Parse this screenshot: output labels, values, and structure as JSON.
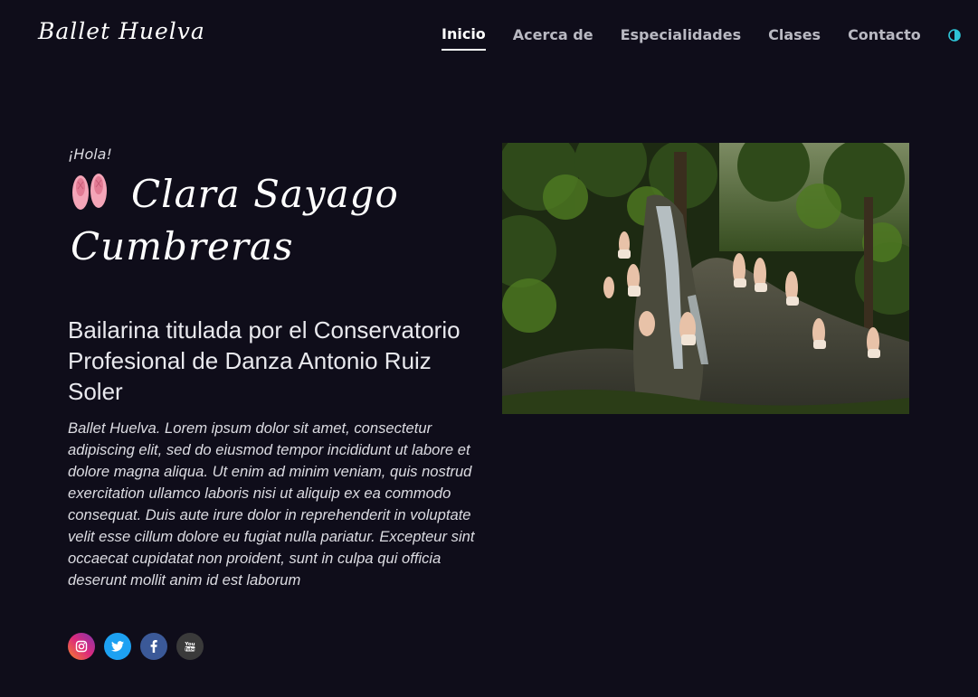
{
  "brand": {
    "logo_text": "Ballet Huelva"
  },
  "nav": {
    "items": [
      {
        "label": "Inicio",
        "active": true
      },
      {
        "label": "Acerca de",
        "active": false
      },
      {
        "label": "Especialidades",
        "active": false
      },
      {
        "label": "Clases",
        "active": false
      },
      {
        "label": "Contacto",
        "active": false
      }
    ],
    "theme_toggle_icon": "half-circle-contrast-icon"
  },
  "hero": {
    "greeting": "¡Hola!",
    "name_line1": "Clara Sayago",
    "name_line2": "Cumbreras",
    "subtitle": "Bailarina titulada por el Conservatorio Profesional de Danza Antonio Ruiz Soler",
    "description": "Ballet Huelva. Lorem ipsum dolor sit amet, consectetur adipiscing elit, sed do eiusmod tempor incididunt ut labore et dolore magna aliqua. Ut enim ad minim veniam, quis nostrud exercitation ullamco laboris nisi ut aliquip ex ea commodo consequat. Duis aute irure dolor in reprehenderit in voluptate velit esse cillum dolore eu fugiat nulla pariatur. Excepteur sint occaecat cupidatat non proident, sunt in culpa qui officia deserunt mollit anim id est laborum"
  },
  "social": [
    {
      "icon": "instagram-icon",
      "color": "#c13584"
    },
    {
      "icon": "twitter-icon",
      "color": "#1da1f2"
    },
    {
      "icon": "facebook-icon",
      "color": "#3b5998"
    },
    {
      "icon": "youtube-icon",
      "color": "#3a3a3a"
    }
  ],
  "colors": {
    "background": "#0f0d1a",
    "accent": "#2ec4d6",
    "shoe_pink": "#f4a5b8"
  }
}
